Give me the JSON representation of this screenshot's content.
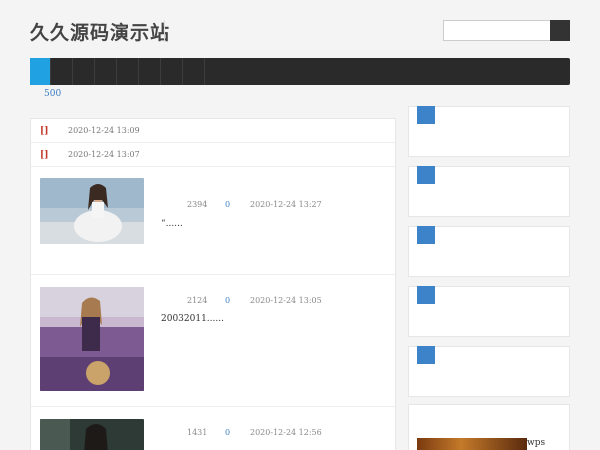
{
  "header": {
    "site_title": "久久源码演示站",
    "search_placeholder": ""
  },
  "nav": {
    "count_label": "500"
  },
  "notices": [
    {
      "tag": "[]",
      "date": "2020-12-24 13:09"
    },
    {
      "tag": "[]",
      "date": "2020-12-24 13:07"
    }
  ],
  "posts": [
    {
      "views": "2394",
      "comments": "0",
      "date": "2020-12-24 13:27",
      "excerpt": "“......"
    },
    {
      "views": "2124",
      "comments": "0",
      "date": "2020-12-24 13:05",
      "excerpt": "20032011......"
    },
    {
      "views": "1431",
      "comments": "0",
      "date": "2020-12-24 12:56",
      "excerpt": ""
    }
  ],
  "sidebar": {
    "wps_label": "wps"
  },
  "colors": {
    "nav_bg": "#2a2a2a",
    "nav_active": "#20a2e2",
    "accent_blue": "#3d83c9",
    "tag_red": "#c0392b"
  }
}
